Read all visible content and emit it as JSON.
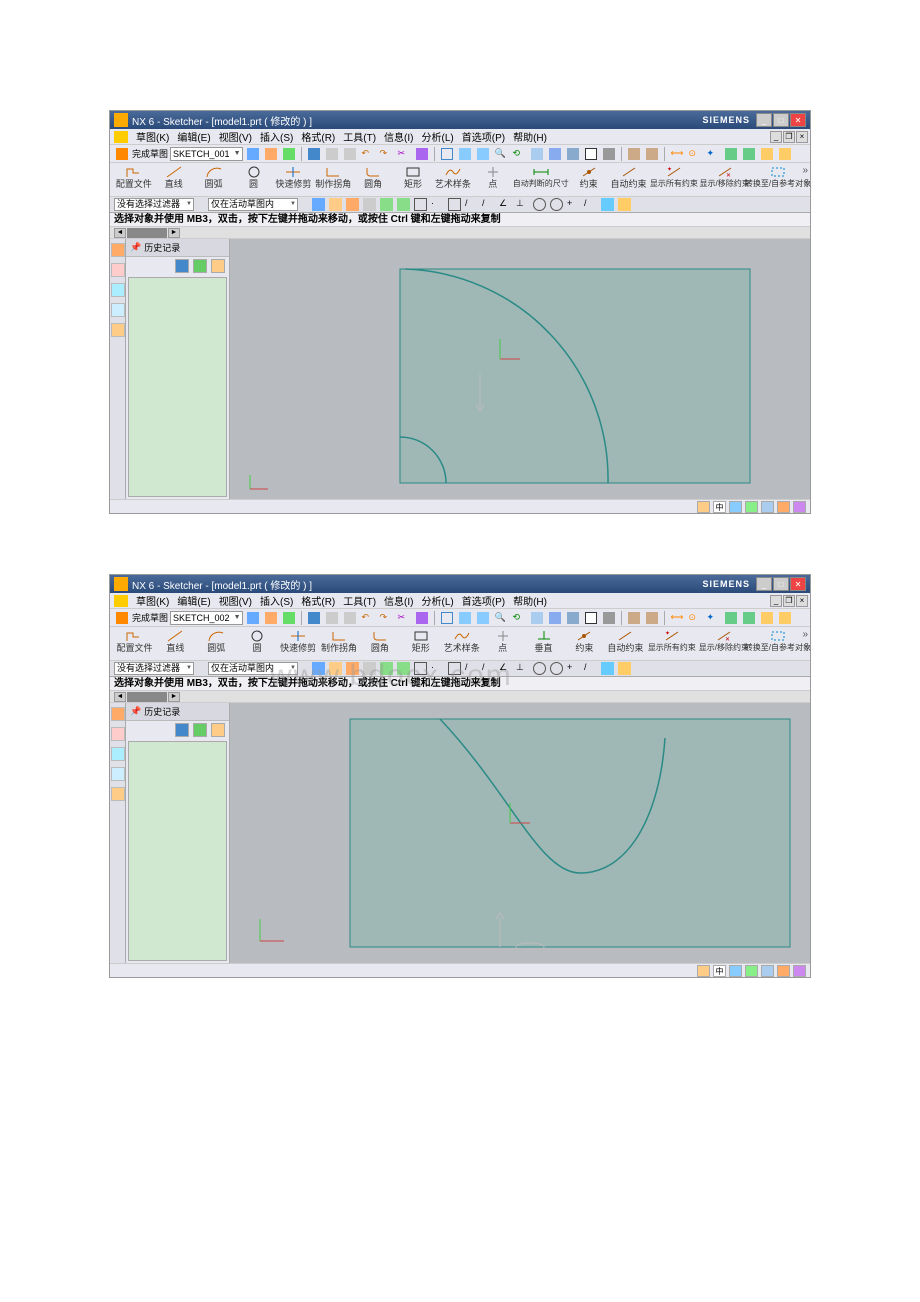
{
  "app": {
    "title": "NX 6 - Sketcher - [model1.prt ( 修改的 ) ]",
    "brand": "SIEMENS"
  },
  "menu": [
    "草图(K)",
    "编辑(E)",
    "视图(V)",
    "插入(S)",
    "格式(R)",
    "工具(T)",
    "信息(I)",
    "分析(L)",
    "首选项(P)",
    "帮助(H)"
  ],
  "sketch_label": "完成草图",
  "sketch1": "SKETCH_001",
  "sketch2": "SKETCH_002",
  "tools": {
    "profile": "配置文件",
    "line": "直线",
    "arc": "圆弧",
    "circle": "圆",
    "quicktrim": "快速修剪",
    "fillet": "制作拐角",
    "chamfer": "圆角",
    "rect": "矩形",
    "spline": "艺术样条",
    "point": "点",
    "autodim1": "自动判断的尺寸",
    "vertical": "垂直",
    "constraint": "约束",
    "autoconstraint": "自动约束",
    "showall": "显示所有约束",
    "showremove": "显示/移除约束",
    "convert": "转换至/自参考对象"
  },
  "filter": {
    "none": "没有选择过滤器",
    "activeonly": "仅在活动草图内"
  },
  "hint": "选择对象并使用 MB3，双击，按下左键并拖动来移动，或按住 Ctrl 键和左键拖动来复制",
  "history": {
    "title": "历史记录",
    "pin": "📌"
  },
  "status_lang": "中",
  "watermark": "www.bdocx.com"
}
